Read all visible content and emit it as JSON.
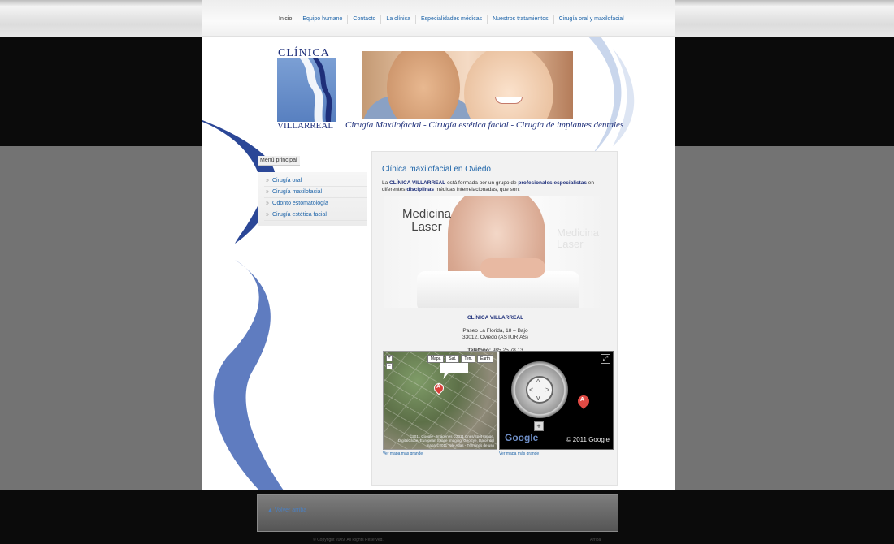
{
  "nav": {
    "items": [
      "Inicio",
      "Equipo humano",
      "Contacto",
      "La clínica",
      "Especialidades médicas",
      "Nuestros tratamientos",
      "Cirugía oral y maxilofacial"
    ]
  },
  "header": {
    "logo_top": "CLÍNICA",
    "logo_bottom": "VILLARREAL",
    "tagline": "Cirugía Maxilofacial - Cirugía estética facial - Cirugía de implantes dentales"
  },
  "sidebar": {
    "title": "Menú principal",
    "items": [
      "Cirugía oral",
      "Cirugía maxilofacial",
      "Odonto estomatología",
      "Cirugía estética facial"
    ]
  },
  "main": {
    "title": "Clínica maxilofacial en Oviedo",
    "intro_a": "La ",
    "intro_brand": "CLÍNICA VILLARREAL",
    "intro_b": " está formada por un grupo de ",
    "intro_bold2": "profesionales especialistas",
    "intro_c": " en diferentes ",
    "intro_bold3": "disciplinas",
    "intro_d": " médicas interrelacionadas, que son:",
    "laser_caption_1": "Medicina",
    "laser_caption_2": "Laser",
    "clinic_name": "CLÍNICA VILLARREAL",
    "address_1": "Paseo La Florida, 18 – Bajo",
    "address_2": "33012, Oviedo (ASTURIAS)",
    "phone_label": "Teléfono:",
    "phone": "985 25 78 13"
  },
  "map_satellite": {
    "buttons": [
      "Mapa",
      "Sat.",
      "Terr.",
      "Earth"
    ],
    "marker": "A",
    "copyright": "©2011 Google - Imágenes ©2011 Cnes/Spot Image, DigitalGlobe, European Space Imaging, GeoEye, Datos del mapa ©2011 Tele Atlas - Términos de uso",
    "link": "Ver mapa más grande"
  },
  "map_street": {
    "marker": "A",
    "brand": "Google",
    "copyright": "© 2011 Google",
    "link": "Ver mapa más grande"
  },
  "footer": {
    "back_link": "Volver arriba",
    "copyright": "© Copyright 2009. All Rights Reserved.",
    "right_text": "Arriba"
  }
}
